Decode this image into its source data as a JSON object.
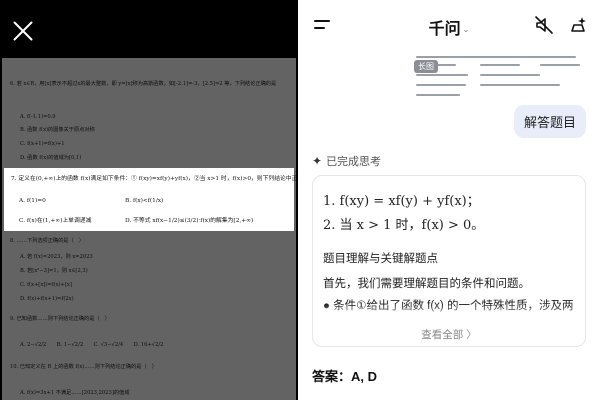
{
  "left_panel": {
    "close_icon": "close-icon",
    "questions": [
      {
        "text": "6. 若 x∈R，用[x]表示不超过x的最大整数，即 y=[x]称为高斯函数。如[-2.1]=-3，[2.5]=2 等，下列结论正确的是"
      },
      {
        "text": "A. f(-1.1)=0.9"
      },
      {
        "text": "B. 函数 f(x)的图像关于原点对称"
      },
      {
        "text": "C. f(x+1)=f(x)+1"
      },
      {
        "text": "D. 函数 f(x)的值域为[0,1)"
      }
    ],
    "crop": {
      "q7": "7. 定义在(0,+∞)上的函数 f(x)满足如下条件：① f(xy)=xf(y)+yf(x)，②当 x>1 时，f(x)>0，则下列结论中正确的是（　）",
      "opt_a": "A. f(1)=0",
      "opt_b": "B. f(x)<f(1/x)",
      "opt_c": "C. f(x)在(1,+∞)上单调递减",
      "opt_d": "D. 不等式 xf(x−1/2)≤(3/2)·f(x)的解集为[2,+∞)"
    },
    "below": [
      {
        "text": "8. ……下列选项正确的是（　）"
      },
      {
        "text": "A. 若 f(x)=2023，则 x=2023"
      },
      {
        "text": "B. 若[x²−3]=1，则 x∈[2,3)"
      },
      {
        "text": "C. f(x+[x])=f(x)+[x]"
      },
      {
        "text": "D. f(x)+f(x+1)=f(2x)"
      },
      {
        "text": "9. 已知函数……则下列结论正确的是（　）"
      },
      {
        "text": "A. 2−√2/2　　B. 1−√2/2　　C. √3−√2/4　　D. 16+√2/2"
      },
      {
        "text": "10. 已知定义在 R 上的函数 f(x)……则下列结论正确的是（　）"
      },
      {
        "text": "A. f(x)=3x+1 不满足……[2023,2023]的值域"
      }
    ]
  },
  "header": {
    "title": "千问",
    "caret": "⌄",
    "menu_icon": "menu-icon",
    "mute_icon": "mute-icon",
    "new_chat_icon": "new-chat-icon"
  },
  "thumbnail": {
    "badge": "长图"
  },
  "user_message": "解答题目",
  "thought_status": "已完成思考",
  "answer_card": {
    "formula_1": "1. f(xy) = xf(y) + yf(x)；",
    "formula_2": "2. 当 x > 1 时，f(x) > 0。",
    "section_title": "题目理解与关键解题点",
    "body_1": "首先，我们需要理解题目的条件和问题。",
    "bullet_1": "● 条件①给出了函数 f(x) 的一个特殊性质，涉及两",
    "view_all": "查看全部 〉"
  },
  "final_answer": "答案：A, D"
}
